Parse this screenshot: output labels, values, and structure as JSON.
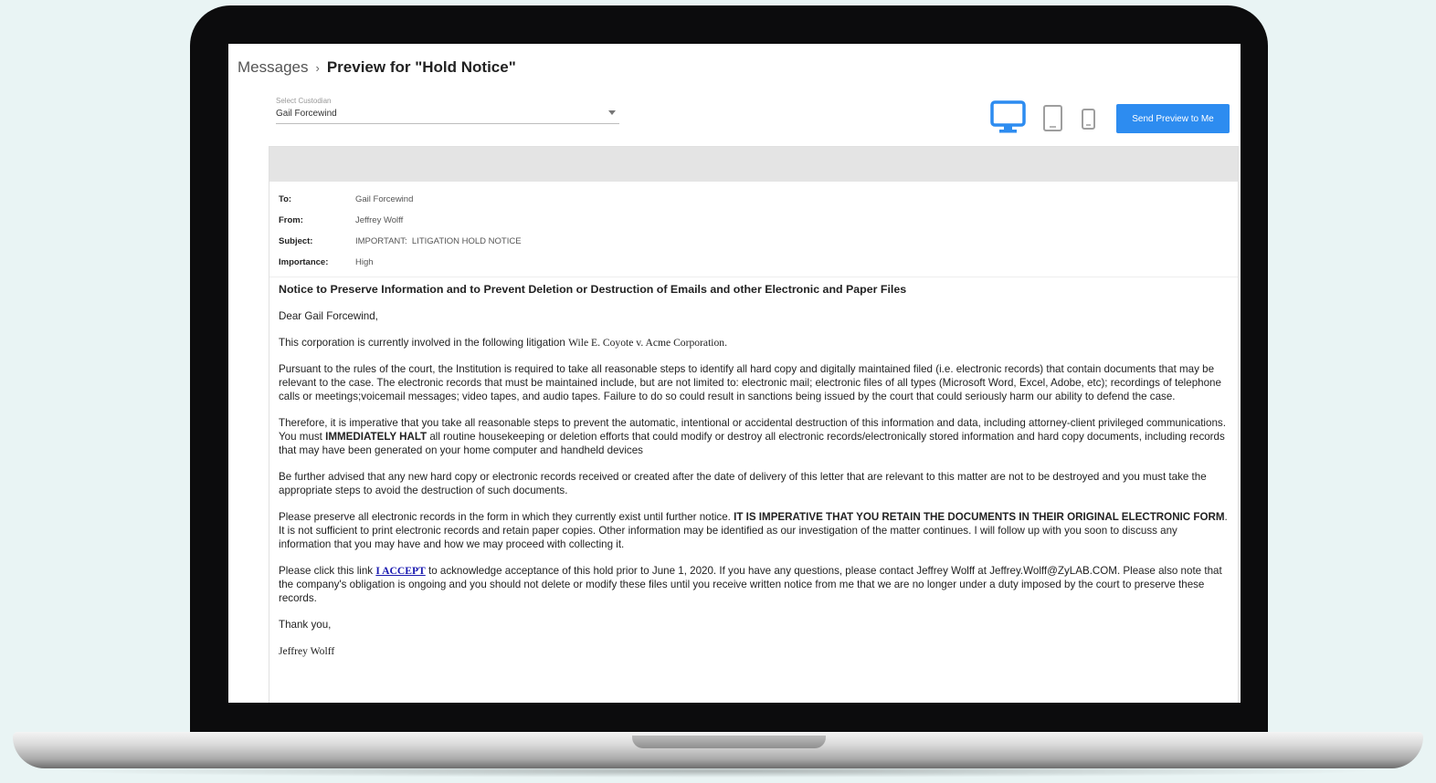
{
  "breadcrumb": {
    "parent": "Messages",
    "separator": "›",
    "current": "Preview for \"Hold Notice\""
  },
  "custodian_select": {
    "label": "Select Custodian",
    "value": "Gail Forcewind"
  },
  "device_toggle": {
    "options": [
      "desktop-icon",
      "tablet-icon",
      "phone-icon"
    ],
    "selected": "desktop-icon",
    "active_color": "#2d8cf0",
    "inactive_color": "#9e9e9e"
  },
  "send_preview_label": "Send Preview to Me",
  "email": {
    "to_label": "To:",
    "to": "Gail Forcewind",
    "from_label": "From:",
    "from": "Jeffrey Wolff",
    "subject_label": "Subject:",
    "subject": "IMPORTANT:  LITIGATION HOLD NOTICE",
    "importance_label": "Importance:",
    "importance": "High",
    "heading": "Notice to Preserve Information and to Prevent Deletion or Destruction of Emails and other Electronic and Paper Files",
    "greeting": "Dear Gail Forcewind,",
    "p1_text": "This corporation is currently involved in the following litigation ",
    "p1_case": "Wile E. Coyote v. Acme Corporation.",
    "p2": "Pursuant to the rules of the court, the Institution is required to take all reasonable steps to identify all hard copy and digitally maintained filed (i.e. electronic records) that contain documents that may be relevant to the case. The electronic records that must be maintained include, but are not limited to: electronic mail; electronic files of all types (Microsoft Word, Excel, Adobe, etc); recordings of telephone calls or meetings;voicemail messages; video tapes, and audio tapes. Failure to do so could result in sanctions being issued by the court that could seriously harm our ability to defend the case.",
    "p3_a": "Therefore, it is imperative that you take all reasonable steps to prevent the automatic, intentional or accidental destruction of this information and data, including attorney-client privileged communications. You must ",
    "p3_bold": "IMMEDIATELY HALT",
    "p3_b": " all routine housekeeping or deletion efforts that could modify or destroy all electronic records/electronically stored information and hard copy documents, including records that may have been generated on your home computer and handheld devices",
    "p4": "Be further advised that any new hard copy or electronic records received or created after the date of delivery of this letter that are relevant to this matter are not to be destroyed and you must take the appropriate steps to avoid the destruction of such documents.",
    "p5_a": "Please preserve all electronic records in the form in which they currently exist until further notice. ",
    "p5_bold": "IT IS IMPERATIVE THAT YOU RETAIN THE DOCUMENTS IN THEIR ORIGINAL ELECTRONIC FORM",
    "p5_b": ". It is not sufficient to print electronic records and retain paper copies. Other information may be identified as our investigation of the matter continues. I will follow up with you soon to discuss any information that you may have and how we may proceed with collecting it.",
    "p6_a": "Please click this link ",
    "p6_link": "I ACCEPT",
    "p6_b": " to acknowledge acceptance of this hold prior to June 1, 2020. If you have any questions, please contact Jeffrey Wolff at Jeffrey.Wolff@ZyLAB.COM. Please also note that the company's obligation is ongoing and you should not delete or modify these files until you receive written notice from me that we are no longer under a duty imposed by the court to preserve these records.",
    "closing": "Thank you,",
    "signature": "Jeffrey Wolff"
  }
}
